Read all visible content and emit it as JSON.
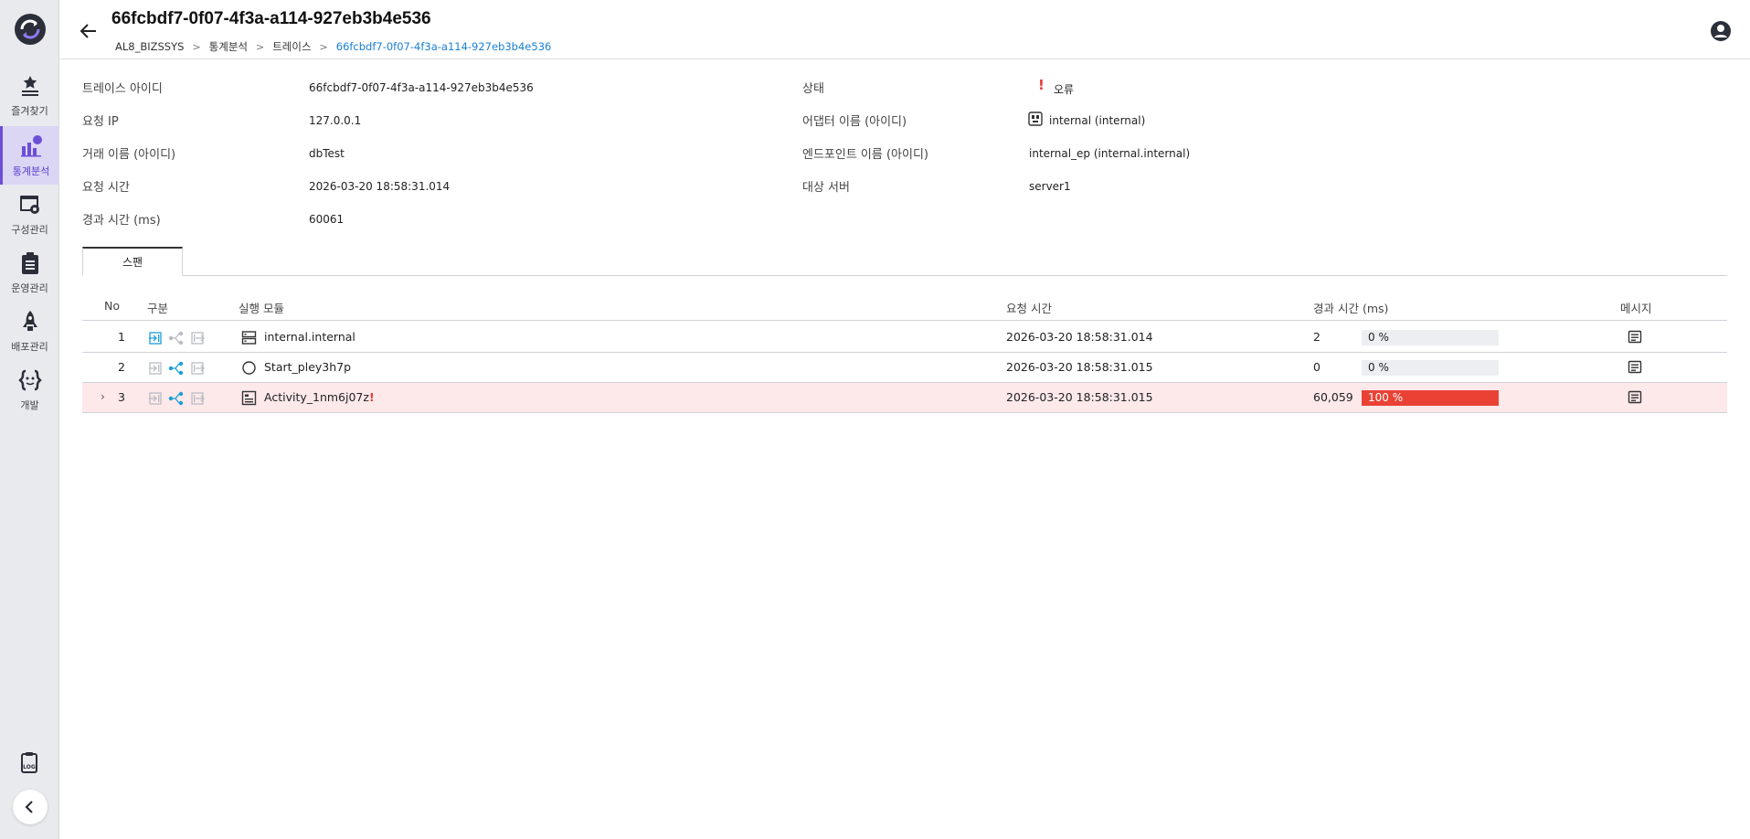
{
  "colors": {
    "accent": "#6b4fd8",
    "link": "#1a7fd4",
    "error": "#e53935",
    "bar_error": "#e94235",
    "row_error_bg": "#fde8ea",
    "kind_active": "#1a9fd8"
  },
  "sidebar": {
    "logo_icon": "refresh-circle-logo",
    "items": [
      {
        "label": "즐겨찾기",
        "icon": "star-list-icon"
      },
      {
        "label": "통계분석",
        "icon": "chart-icon",
        "active": true
      },
      {
        "label": "구성관리",
        "icon": "window-settings-icon"
      },
      {
        "label": "운영관리",
        "icon": "clipboard-icon"
      },
      {
        "label": "배포관리",
        "icon": "rocket-icon"
      },
      {
        "label": "개발",
        "icon": "code-braces-icon"
      }
    ],
    "log_icon": "log-icon",
    "collapse_icon": "chevron-left-icon"
  },
  "header": {
    "title": "66fcbdf7-0f07-4f3a-a114-927eb3b4e536",
    "breadcrumb": [
      "AL8_BIZSSYS",
      "통계분석",
      "트레이스",
      "66fcbdf7-0f07-4f3a-a114-927eb3b4e536"
    ]
  },
  "info": {
    "trace_id": {
      "label": "트레이스 아이디",
      "value": "66fcbdf7-0f07-4f3a-a114-927eb3b4e536"
    },
    "request_ip": {
      "label": "요청 IP",
      "value": "127.0.0.1"
    },
    "transaction": {
      "label": "거래 이름 (아이디)",
      "value": "dbTest"
    },
    "request_time": {
      "label": "요청 시간",
      "value": "2026-03-20 18:58:31.014"
    },
    "elapsed": {
      "label": "경과 시간 (ms)",
      "value": "60061"
    },
    "status": {
      "label": "상태",
      "value": "오류",
      "mark": "!"
    },
    "adapter": {
      "label": "어댑터 이름 (아이디)",
      "value": "internal (internal)"
    },
    "endpoint": {
      "label": "엔드포인트 이름 (아이디)",
      "value": "internal_ep (internal.internal)"
    },
    "target_server": {
      "label": "대상 서버",
      "value": "server1"
    }
  },
  "tabs": [
    {
      "label": "스팬"
    }
  ],
  "table": {
    "headers": {
      "no": "No",
      "kind": "구분",
      "module": "실행 모듈",
      "time": "요청 시간",
      "elapsed": "경과 시간 (ms)",
      "message": "메시지"
    },
    "rows": [
      {
        "no": "1",
        "kind_active": "in",
        "module_icon": "server-icon",
        "module": "internal.internal",
        "time": "2026-03-20 18:58:31.014",
        "elapsed": "2",
        "percent": 0,
        "percent_label": "0 %",
        "error": false,
        "expand": ""
      },
      {
        "no": "2",
        "kind_active": "flow",
        "module_icon": "circle-icon",
        "module": "Start_pley3h7p",
        "time": "2026-03-20 18:58:31.015",
        "elapsed": "0",
        "percent": 0,
        "percent_label": "0 %",
        "error": false,
        "expand": ""
      },
      {
        "no": "3",
        "kind_active": "flow",
        "module_icon": "activity-icon",
        "module": "Activity_1nm6j07z",
        "time": "2026-03-20 18:58:31.015",
        "elapsed": "60,059",
        "percent": 100,
        "percent_label": "100 %",
        "error": true,
        "expand": "›",
        "error_mark": "!"
      }
    ]
  }
}
